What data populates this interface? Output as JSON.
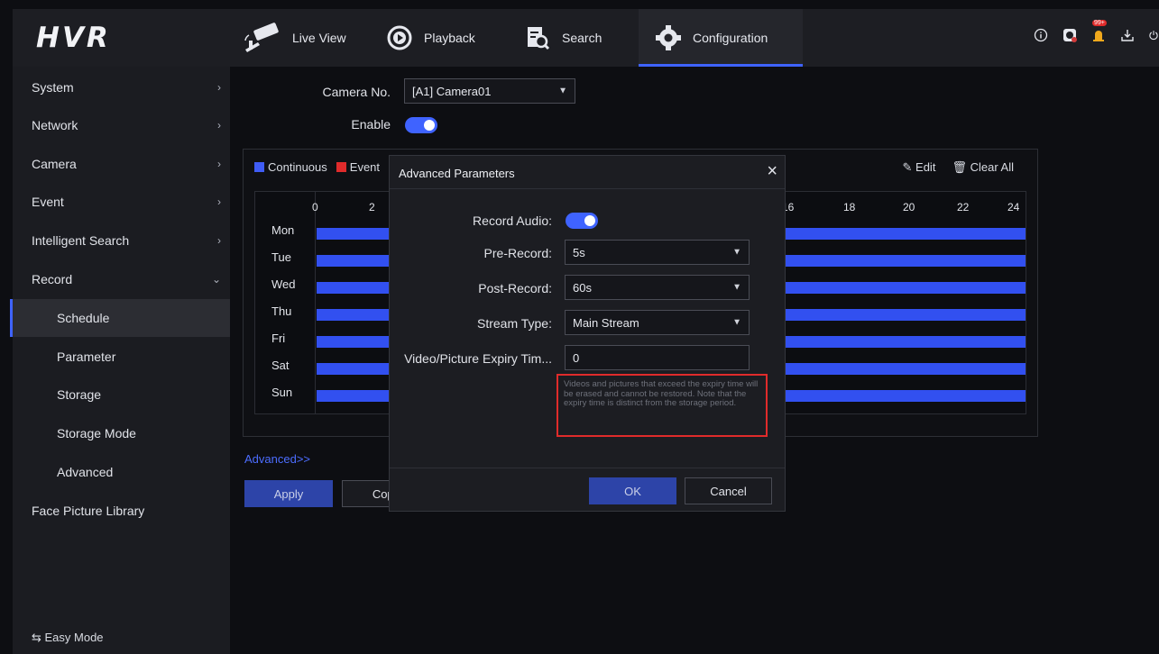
{
  "app": {
    "logo": "HVR"
  },
  "nav": [
    {
      "label": "Live View",
      "icon": "camera-icon"
    },
    {
      "label": "Playback",
      "icon": "playback-icon"
    },
    {
      "label": "Search",
      "icon": "search-icon"
    },
    {
      "label": "Configuration",
      "icon": "gear-icon",
      "active": true
    }
  ],
  "top_icons": [
    "info-icon",
    "disk-icon",
    "alarm-icon",
    "download-icon",
    "power-icon"
  ],
  "alarm_badge": "99+",
  "sidebar": {
    "items": [
      {
        "label": "System",
        "arrow": "›"
      },
      {
        "label": "Network",
        "arrow": "›"
      },
      {
        "label": "Camera",
        "arrow": "›"
      },
      {
        "label": "Event",
        "arrow": "›"
      },
      {
        "label": "Intelligent Search",
        "arrow": "›"
      },
      {
        "label": "Record",
        "arrow": "⌄"
      },
      {
        "label": "Schedule",
        "sub": true,
        "active": true
      },
      {
        "label": "Parameter",
        "sub": true
      },
      {
        "label": "Storage",
        "sub": true
      },
      {
        "label": "Storage Mode",
        "sub": true
      },
      {
        "label": "Advanced",
        "sub": true
      },
      {
        "label": "Face Picture Library"
      }
    ],
    "easy_mode": "⇆ Easy Mode"
  },
  "form": {
    "camera_label": "Camera No.",
    "camera_value": "[A1] Camera01",
    "enable_label": "Enable",
    "enable_on": true
  },
  "schedule": {
    "legend_continuous": "Continuous",
    "legend_event": "Event",
    "continuous_color": "#3f5cf5",
    "event_color": "#e02b2b",
    "edit_label": "Edit",
    "clear_label": "Clear All",
    "hours": [
      "0",
      "2",
      "16",
      "18",
      "20",
      "22",
      "24"
    ],
    "days": [
      "Mon",
      "Tue",
      "Wed",
      "Thu",
      "Fri",
      "Sat",
      "Sun"
    ]
  },
  "advanced_link": "Advanced>>",
  "apply_label": "Apply",
  "copy_label": "Copy",
  "modal": {
    "title": "Advanced Parameters",
    "close": "×",
    "record_audio_label": "Record Audio:",
    "record_audio_on": true,
    "pre_record_label": "Pre-Record:",
    "pre_record_value": "5s",
    "post_record_label": "Post-Record:",
    "post_record_value": "60s",
    "stream_type_label": "Stream Type:",
    "stream_type_value": "Main Stream",
    "expiry_label": "Video/Picture Expiry Tim...",
    "expiry_value": "0",
    "hint": "Videos and pictures that exceed the expiry time will be erased and cannot be restored. Note that the expiry time is distinct from the storage period.",
    "ok_label": "OK",
    "cancel_label": "Cancel"
  }
}
